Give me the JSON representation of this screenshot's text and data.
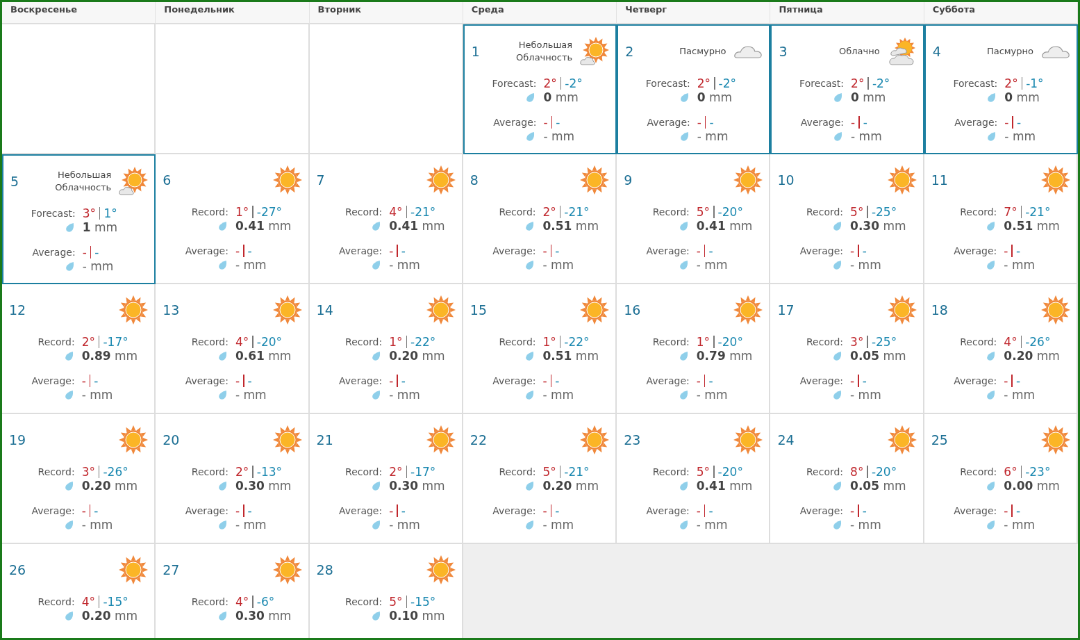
{
  "weekdays": [
    "Воскресенье",
    "Понедельник",
    "Вторник",
    "Среда",
    "Четверг",
    "Пятница",
    "Суббота"
  ],
  "weeks": [
    {
      "cells": [
        {
          "kind": "blank"
        },
        {
          "kind": "blank"
        },
        {
          "kind": "blank"
        },
        {
          "kind": "partlycloudy",
          "day": "1",
          "highlighted": true,
          "condition": "Небольшая Облачность",
          "label": "Forecast:",
          "high": "2°",
          "low": "-2°",
          "precip": "0",
          "unit": "mm",
          "average": {
            "label": "Average:",
            "high": "-",
            "low": "-",
            "precip": "-",
            "unit": "mm"
          }
        },
        {
          "kind": "overcast",
          "day": "2",
          "highlighted": true,
          "condition": "Пасмурно",
          "label": "Forecast:",
          "high": "2°",
          "low": "-2°",
          "precip": "0",
          "unit": "mm",
          "average": {
            "label": "Average:",
            "high": "-",
            "low": "-",
            "precip": "-",
            "unit": "mm"
          }
        },
        {
          "kind": "cloudy",
          "day": "3",
          "highlighted": true,
          "condition": "Облачно",
          "label": "Forecast:",
          "high": "2°",
          "low": "-2°",
          "precip": "0",
          "unit": "mm",
          "average": {
            "label": "Average:",
            "high": "-",
            "low": "-",
            "precip": "-",
            "unit": "mm"
          }
        },
        {
          "kind": "overcast",
          "day": "4",
          "highlighted": true,
          "condition": "Пасмурно",
          "label": "Forecast:",
          "high": "2°",
          "low": "-1°",
          "precip": "0",
          "unit": "mm",
          "average": {
            "label": "Average:",
            "high": "-",
            "low": "-",
            "precip": "-",
            "unit": "mm"
          }
        }
      ]
    },
    {
      "cells": [
        {
          "kind": "partlycloudy",
          "day": "5",
          "highlighted": true,
          "condition": "Небольшая Облачность",
          "label": "Forecast:",
          "high": "3°",
          "low": "1°",
          "precip": "1",
          "unit": "mm",
          "average": {
            "label": "Average:",
            "high": "-",
            "low": "-",
            "precip": "-",
            "unit": "mm"
          }
        },
        {
          "kind": "sunny",
          "day": "6",
          "highlighted": false,
          "label": "Record:",
          "high": "1°",
          "low": "-27°",
          "precip": "0.41",
          "unit": "mm",
          "average": {
            "label": "Average:",
            "high": "-",
            "low": "-",
            "precip": "-",
            "unit": "mm"
          }
        },
        {
          "kind": "sunny",
          "day": "7",
          "highlighted": false,
          "label": "Record:",
          "high": "4°",
          "low": "-21°",
          "precip": "0.41",
          "unit": "mm",
          "average": {
            "label": "Average:",
            "high": "-",
            "low": "-",
            "precip": "-",
            "unit": "mm"
          }
        },
        {
          "kind": "sunny",
          "day": "8",
          "highlighted": false,
          "label": "Record:",
          "high": "2°",
          "low": "-21°",
          "precip": "0.51",
          "unit": "mm",
          "average": {
            "label": "Average:",
            "high": "-",
            "low": "-",
            "precip": "-",
            "unit": "mm"
          }
        },
        {
          "kind": "sunny",
          "day": "9",
          "highlighted": false,
          "label": "Record:",
          "high": "5°",
          "low": "-20°",
          "precip": "0.41",
          "unit": "mm",
          "average": {
            "label": "Average:",
            "high": "-",
            "low": "-",
            "precip": "-",
            "unit": "mm"
          }
        },
        {
          "kind": "sunny",
          "day": "10",
          "highlighted": false,
          "label": "Record:",
          "high": "5°",
          "low": "-25°",
          "precip": "0.30",
          "unit": "mm",
          "average": {
            "label": "Average:",
            "high": "-",
            "low": "-",
            "precip": "-",
            "unit": "mm"
          }
        },
        {
          "kind": "sunny",
          "day": "11",
          "highlighted": false,
          "label": "Record:",
          "high": "7°",
          "low": "-21°",
          "precip": "0.51",
          "unit": "mm",
          "average": {
            "label": "Average:",
            "high": "-",
            "low": "-",
            "precip": "-",
            "unit": "mm"
          }
        }
      ]
    },
    {
      "cells": [
        {
          "kind": "sunny",
          "day": "12",
          "highlighted": false,
          "label": "Record:",
          "high": "2°",
          "low": "-17°",
          "precip": "0.89",
          "unit": "mm",
          "average": {
            "label": "Average:",
            "high": "-",
            "low": "-",
            "precip": "-",
            "unit": "mm"
          }
        },
        {
          "kind": "sunny",
          "day": "13",
          "highlighted": false,
          "label": "Record:",
          "high": "4°",
          "low": "-20°",
          "precip": "0.61",
          "unit": "mm",
          "average": {
            "label": "Average:",
            "high": "-",
            "low": "-",
            "precip": "-",
            "unit": "mm"
          }
        },
        {
          "kind": "sunny",
          "day": "14",
          "highlighted": false,
          "label": "Record:",
          "high": "1°",
          "low": "-22°",
          "precip": "0.20",
          "unit": "mm",
          "average": {
            "label": "Average:",
            "high": "-",
            "low": "-",
            "precip": "-",
            "unit": "mm"
          }
        },
        {
          "kind": "sunny",
          "day": "15",
          "highlighted": false,
          "label": "Record:",
          "high": "1°",
          "low": "-22°",
          "precip": "0.51",
          "unit": "mm",
          "average": {
            "label": "Average:",
            "high": "-",
            "low": "-",
            "precip": "-",
            "unit": "mm"
          }
        },
        {
          "kind": "sunny",
          "day": "16",
          "highlighted": false,
          "label": "Record:",
          "high": "1°",
          "low": "-20°",
          "precip": "0.79",
          "unit": "mm",
          "average": {
            "label": "Average:",
            "high": "-",
            "low": "-",
            "precip": "-",
            "unit": "mm"
          }
        },
        {
          "kind": "sunny",
          "day": "17",
          "highlighted": false,
          "label": "Record:",
          "high": "3°",
          "low": "-25°",
          "precip": "0.05",
          "unit": "mm",
          "average": {
            "label": "Average:",
            "high": "-",
            "low": "-",
            "precip": "-",
            "unit": "mm"
          }
        },
        {
          "kind": "sunny",
          "day": "18",
          "highlighted": false,
          "label": "Record:",
          "high": "4°",
          "low": "-26°",
          "precip": "0.20",
          "unit": "mm",
          "average": {
            "label": "Average:",
            "high": "-",
            "low": "-",
            "precip": "-",
            "unit": "mm"
          }
        }
      ]
    },
    {
      "cells": [
        {
          "kind": "sunny",
          "day": "19",
          "highlighted": false,
          "label": "Record:",
          "high": "3°",
          "low": "-26°",
          "precip": "0.20",
          "unit": "mm",
          "average": {
            "label": "Average:",
            "high": "-",
            "low": "-",
            "precip": "-",
            "unit": "mm"
          }
        },
        {
          "kind": "sunny",
          "day": "20",
          "highlighted": false,
          "label": "Record:",
          "high": "2°",
          "low": "-13°",
          "precip": "0.30",
          "unit": "mm",
          "average": {
            "label": "Average:",
            "high": "-",
            "low": "-",
            "precip": "-",
            "unit": "mm"
          }
        },
        {
          "kind": "sunny",
          "day": "21",
          "highlighted": false,
          "label": "Record:",
          "high": "2°",
          "low": "-17°",
          "precip": "0.30",
          "unit": "mm",
          "average": {
            "label": "Average:",
            "high": "-",
            "low": "-",
            "precip": "-",
            "unit": "mm"
          }
        },
        {
          "kind": "sunny",
          "day": "22",
          "highlighted": false,
          "label": "Record:",
          "high": "5°",
          "low": "-21°",
          "precip": "0.20",
          "unit": "mm",
          "average": {
            "label": "Average:",
            "high": "-",
            "low": "-",
            "precip": "-",
            "unit": "mm"
          }
        },
        {
          "kind": "sunny",
          "day": "23",
          "highlighted": false,
          "label": "Record:",
          "high": "5°",
          "low": "-20°",
          "precip": "0.41",
          "unit": "mm",
          "average": {
            "label": "Average:",
            "high": "-",
            "low": "-",
            "precip": "-",
            "unit": "mm"
          }
        },
        {
          "kind": "sunny",
          "day": "24",
          "highlighted": false,
          "label": "Record:",
          "high": "8°",
          "low": "-20°",
          "precip": "0.05",
          "unit": "mm",
          "average": {
            "label": "Average:",
            "high": "-",
            "low": "-",
            "precip": "-",
            "unit": "mm"
          }
        },
        {
          "kind": "sunny",
          "day": "25",
          "highlighted": false,
          "label": "Record:",
          "high": "6°",
          "low": "-23°",
          "precip": "0.00",
          "unit": "mm",
          "average": {
            "label": "Average:",
            "high": "-",
            "low": "-",
            "precip": "-",
            "unit": "mm"
          }
        }
      ]
    },
    {
      "cells": [
        {
          "kind": "sunny",
          "day": "26",
          "highlighted": false,
          "label": "Record:",
          "high": "4°",
          "low": "-15°",
          "precip": "0.20",
          "unit": "mm"
        },
        {
          "kind": "sunny",
          "day": "27",
          "highlighted": false,
          "label": "Record:",
          "high": "4°",
          "low": "-6°",
          "precip": "0.30",
          "unit": "mm"
        },
        {
          "kind": "sunny",
          "day": "28",
          "highlighted": false,
          "label": "Record:",
          "high": "5°",
          "low": "-15°",
          "precip": "0.10",
          "unit": "mm"
        },
        {
          "kind": "filler"
        },
        {
          "kind": "filler"
        },
        {
          "kind": "filler"
        },
        {
          "kind": "filler"
        }
      ]
    }
  ]
}
